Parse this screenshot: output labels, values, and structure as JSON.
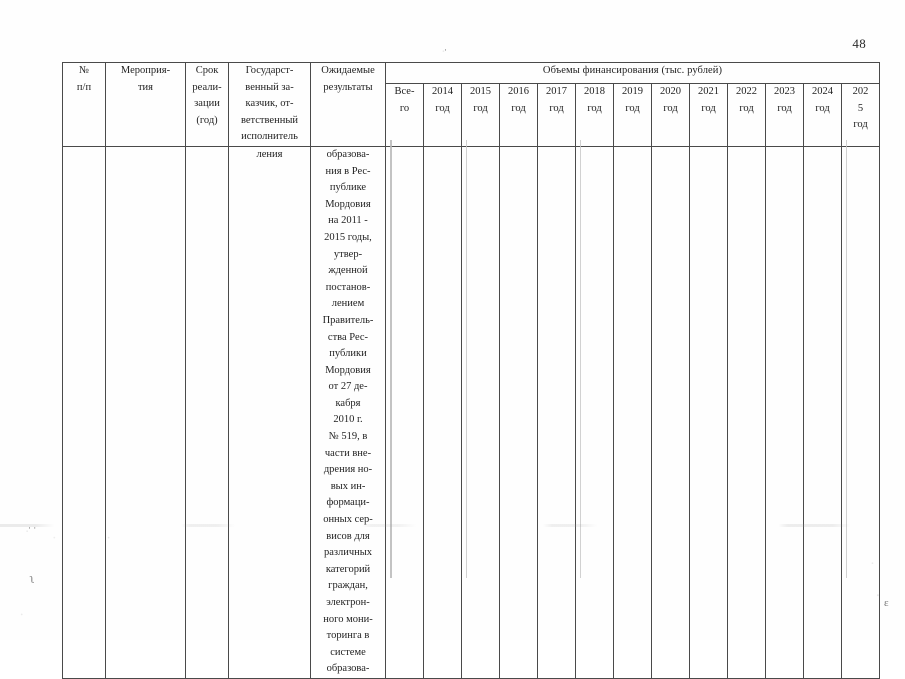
{
  "page": {
    "folio": "48",
    "paper_color": "#fefefe",
    "ink_color": "#1f1f1f",
    "rule_color": "#4a4a4a"
  },
  "table": {
    "header": {
      "col_no": [
        "№",
        "п/п"
      ],
      "col_measure": [
        "Мероприя-",
        "тия"
      ],
      "col_term": [
        "Срок",
        "реали-",
        "зации",
        "(год)"
      ],
      "col_customer": [
        "Государст-",
        "венный за-",
        "казчик, от-",
        "ветственный",
        "исполнитель"
      ],
      "col_results": [
        "Ожидаемые",
        "результаты"
      ],
      "funding_group": "Объемы финансирования (тыс. рублей)",
      "funding_columns": [
        {
          "lines": [
            "Все-",
            "го"
          ]
        },
        {
          "lines": [
            "2014",
            "год"
          ]
        },
        {
          "lines": [
            "2015",
            "год"
          ]
        },
        {
          "lines": [
            "2016",
            "год"
          ]
        },
        {
          "lines": [
            "2017",
            "год"
          ]
        },
        {
          "lines": [
            "2018",
            "год"
          ]
        },
        {
          "lines": [
            "2019",
            "год"
          ]
        },
        {
          "lines": [
            "2020",
            "год"
          ]
        },
        {
          "lines": [
            "2021",
            "год"
          ]
        },
        {
          "lines": [
            "2022",
            "год"
          ]
        },
        {
          "lines": [
            "2023",
            "год"
          ]
        },
        {
          "lines": [
            "2024",
            "год"
          ]
        },
        {
          "lines": [
            "202",
            "5",
            "год"
          ]
        }
      ]
    },
    "body_row": {
      "col_no": [],
      "col_measure": [],
      "col_term": [],
      "col_customer": [
        "ления"
      ],
      "col_results": [
        "образова-",
        "ния в Рес-",
        "публике",
        "Мордовия",
        "на 2011 -",
        "2015 годы,",
        "утвер-",
        "жденной",
        "постанов-",
        "лением",
        "Правитель-",
        "ства Рес-",
        "публики",
        "Мордовия",
        "от 27 де-",
        "кабря",
        "2010 г.",
        "№ 519, в",
        "части вне-",
        "дрения но-",
        "вых ин-",
        "формаци-",
        "онных сер-",
        "висов для",
        "различных",
        "категорий",
        "граждан,",
        "электрон-",
        "ного мони-",
        "торинга в",
        "системе",
        "образова-"
      ],
      "funding_values": [
        "",
        "",
        "",
        "",
        "",
        "",
        "",
        "",
        "",
        "",
        "",
        "",
        ""
      ]
    }
  },
  "scan_marks": {
    "left_upper": "·",
    "left_lower": "ʅ",
    "bottom_left": "· ·",
    "right_lower": "ɛ"
  }
}
